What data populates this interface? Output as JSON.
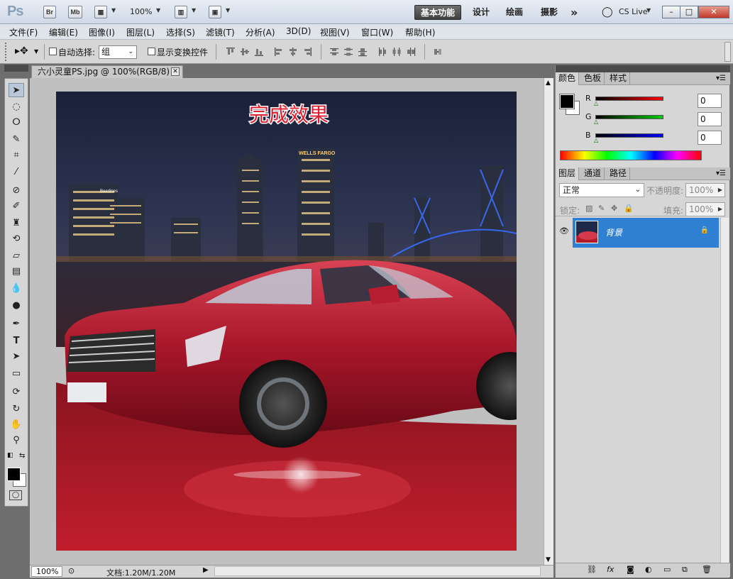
{
  "app": {
    "logo": "Ps",
    "bridge_btn": "Br",
    "minibridge_btn": "Mb",
    "zoom": "100%",
    "workspaces": [
      "基本功能",
      "设计",
      "绘画",
      "摄影"
    ],
    "more": "»",
    "cslive": "CS Live"
  },
  "menu": [
    "文件(F)",
    "编辑(E)",
    "图像(I)",
    "图层(L)",
    "选择(S)",
    "滤镜(T)",
    "分析(A)",
    "3D(D)",
    "视图(V)",
    "窗口(W)",
    "帮助(H)"
  ],
  "options": {
    "auto_select_label": "自动选择:",
    "auto_select_value": "组",
    "show_transform_label": "显示变换控件"
  },
  "document": {
    "tab_title": "六小灵童PS.jpg @ 100%(RGB/8) *",
    "close": "✕",
    "caption": "完成效果",
    "logo_a": "Beerlines",
    "logo_b": "WELLS FARGO"
  },
  "status": {
    "zoom": "100%",
    "doc_size": "文档:1.20M/1.20M"
  },
  "color_panel": {
    "tabs": [
      "颜色",
      "色板",
      "样式"
    ],
    "channels": [
      {
        "label": "R",
        "value": "0",
        "color": "#cc0000"
      },
      {
        "label": "G",
        "value": "0",
        "color": "#00aa00"
      },
      {
        "label": "B",
        "value": "0",
        "color": "#0000cc"
      }
    ]
  },
  "layers_panel": {
    "tabs": [
      "图层",
      "通道",
      "路径"
    ],
    "blend_mode": "正常",
    "opacity_label": "不透明度:",
    "opacity_value": "100%",
    "lock_label": "锁定:",
    "fill_label": "填充:",
    "fill_value": "100%",
    "layer_name": "背景"
  },
  "colors": {
    "accent": "#2f7fd3",
    "car_red": "#b5192a",
    "sky": "#1c2340"
  }
}
